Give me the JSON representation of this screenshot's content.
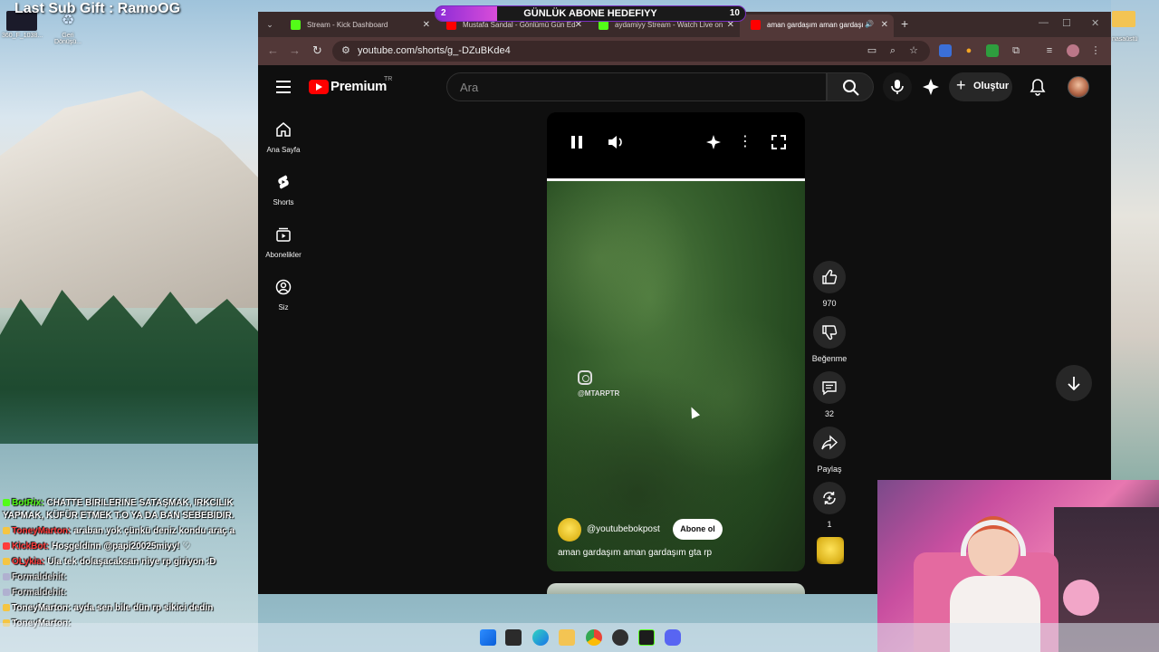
{
  "overlay": {
    "sub_gift": "Last Sub Gift : RamoOG",
    "goal": {
      "title": "GÜNLÜK ABONE HEDEFIYY",
      "current": "2",
      "target": "10",
      "progress": 0.2
    }
  },
  "desktop": {
    "icons": [
      {
        "label": "360_F_1038...",
        "name": "image-file-icon"
      },
      {
        "label": "Geri Dönüşü...",
        "name": "recycle-bin-icon"
      }
    ],
    "right_label": "nasaüstü"
  },
  "browser": {
    "tabs": [
      {
        "title": "Stream - Kick Dashboard",
        "color": "#53fc18"
      },
      {
        "title": "Mustafa Sandal - Gönlümü Gün Ed",
        "color": "#ff0000"
      },
      {
        "title": "aydamiyy Stream - Watch Live on",
        "color": "#53fc18"
      },
      {
        "title": "aman gardaşım aman gardaşı",
        "color": "#ff0000"
      }
    ],
    "url": "youtube.com/shorts/g_-DZuBKde4"
  },
  "youtube": {
    "brand": "Premium",
    "region": "TR",
    "search_placeholder": "Ara",
    "create_label": "Oluştur",
    "sidebar": [
      {
        "label": "Ana Sayfa",
        "icon": "home-icon"
      },
      {
        "label": "Shorts",
        "icon": "shorts-icon"
      },
      {
        "label": "Abonelikler",
        "icon": "subscriptions-icon"
      },
      {
        "label": "Siz",
        "icon": "you-icon"
      }
    ],
    "short": {
      "watermark_handle": "@MTARPTR",
      "channel": "@youtubebokpost",
      "subscribe_label": "Abone ol",
      "title": "aman gardaşım aman gardaşım gta rp"
    },
    "actions": {
      "like_count": "970",
      "dislike_label": "Beğenme",
      "comment_count": "32",
      "share_label": "Paylaş",
      "remix_count": "1"
    }
  },
  "chat": [
    {
      "user": "BotRix:",
      "color": "#53fc18",
      "text": "CHATTE BIRILERINE SATAŞMAK, IRKCILIK YAPMAK, KÜFÜR ETMEK T.O YA DA BAN SEBEBIDIR."
    },
    {
      "user": "ToneyMarton:",
      "color": "#ff3b3b",
      "text": "araban yok çünkü deniz kondu araç a"
    },
    {
      "user": "KickBot:",
      "color": "#ff3b3b",
      "text": "Hoşgeldinn @papi20025miyy! ♡"
    },
    {
      "user": "OLykia:",
      "color": "#ff3b3b",
      "text": "Ula tek dolaşacaksan niye rp giriyon :D"
    },
    {
      "user": "Formaldehit:",
      "color": "#e0e0e0",
      "text": ""
    },
    {
      "user": "Formaldehit:",
      "color": "#e0e0e0",
      "text": ""
    },
    {
      "user": "ToneyMarton:",
      "color": "#ffffff",
      "text": "ayda sen bile dün rp sikici dedin"
    },
    {
      "user": "ToneyMarton:",
      "color": "#ffffff",
      "text": ""
    }
  ]
}
